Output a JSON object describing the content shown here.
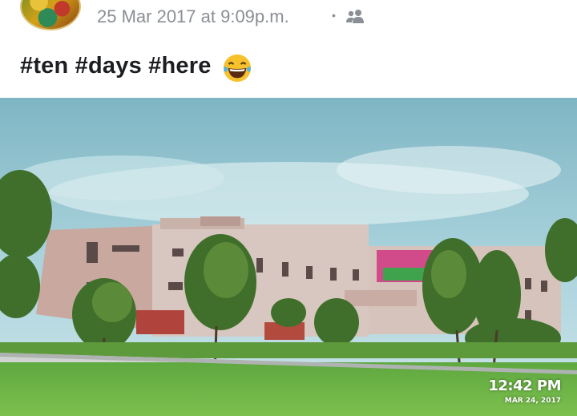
{
  "post": {
    "timestamp": "25 Mar 2017 at 9:09p.m.",
    "separator": "•",
    "audience_icon": "friends-icon",
    "text": "#ten #days #here",
    "emoji_icon": "laughing-tears-emoji"
  },
  "photo": {
    "camera_time": "12:42 PM",
    "camera_date": "MAR 24, 2017"
  }
}
